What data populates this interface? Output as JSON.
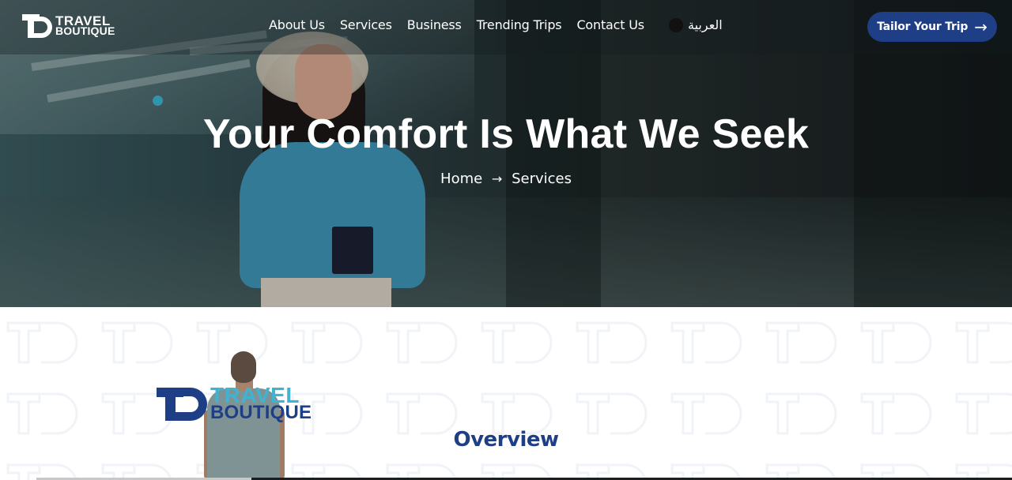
{
  "brand": {
    "line1": "TRAVEL",
    "line2": "BOUTIQUE",
    "primary_color": "#1e3f86",
    "accent_color": "#3fb3d3"
  },
  "nav": {
    "items": [
      {
        "label": "About Us"
      },
      {
        "label": "Services"
      },
      {
        "label": "Business"
      },
      {
        "label": "Trending Trips"
      },
      {
        "label": "Contact Us"
      }
    ],
    "language": "العربية",
    "cta_label": "Tailor Your Trip",
    "cta_icon": "arrow-right-icon"
  },
  "hero": {
    "title": "Your Comfort Is What We Seek",
    "breadcrumb": {
      "home": "Home",
      "separator": "→",
      "current": "Services"
    }
  },
  "content": {
    "brand_logo": {
      "line1": "TRAVEL",
      "line2": "BOUTIQUE"
    },
    "section_title": "Overview"
  }
}
